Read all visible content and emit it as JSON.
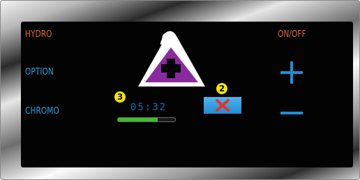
{
  "panel": {
    "left_buttons": [
      {
        "label": "HYDRO",
        "color": "#d9683a"
      },
      {
        "label": "OPTION",
        "color": "#29a3de"
      },
      {
        "label": "CHROMO",
        "color": "#29a3de"
      }
    ],
    "right_buttons": {
      "power_label": "ON/OFF",
      "increase_icon": "plus-icon",
      "decrease_icon": "minus-icon"
    },
    "warning": {
      "icon": "warning-triangle-icon",
      "symbol": "cross-icon",
      "color": "#8a2a9e"
    },
    "timer": {
      "value": "05:32",
      "progress": 0.7
    },
    "cancel": {
      "icon": "close-icon",
      "color": "#e8321e"
    },
    "callouts": {
      "timer_badge": "3",
      "cancel_badge": "2"
    }
  }
}
